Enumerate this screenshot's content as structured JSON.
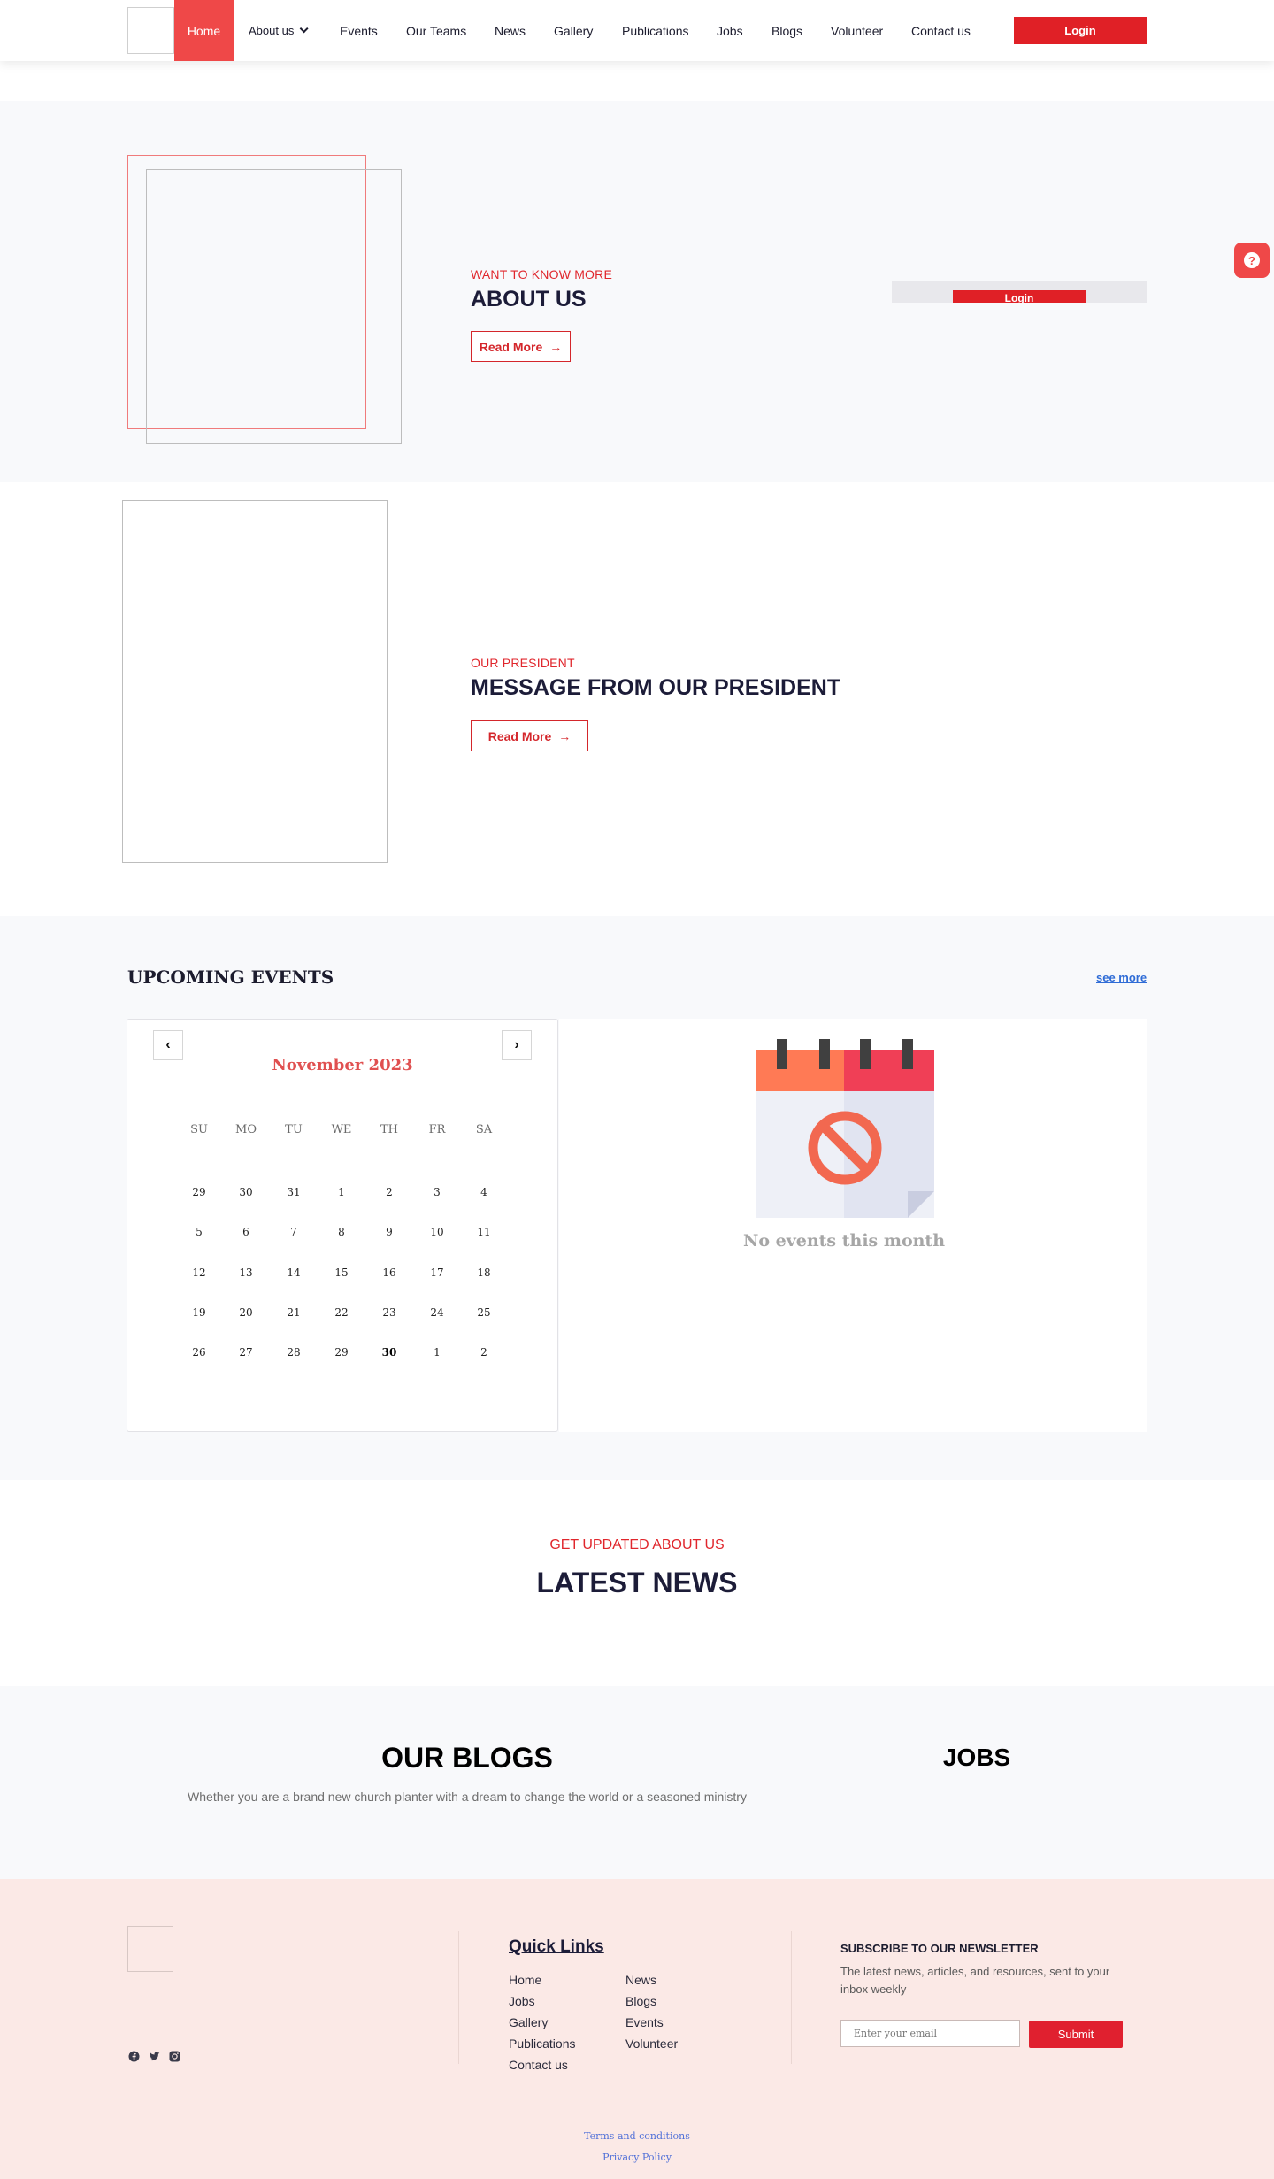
{
  "nav": {
    "home": "Home",
    "about": "About us",
    "events": "Events",
    "teams": "Our Teams",
    "news": "News",
    "gallery": "Gallery",
    "publications": "Publications",
    "jobs": "Jobs",
    "blogs": "Blogs",
    "volunteer": "Volunteer",
    "contact": "Contact us",
    "login": "Login",
    "active_color": "#ef4848",
    "login_color": "#e02026"
  },
  "about": {
    "eyebrow": "WANT TO KNOW MORE",
    "title": "ABOUT US",
    "button": "Read More",
    "mini_login": "Login"
  },
  "help": {
    "icon": "help-question-icon"
  },
  "president": {
    "eyebrow": "OUR PRESIDENT",
    "title": "MESSAGE FROM OUR PRESIDENT",
    "button": "Read More"
  },
  "events": {
    "title": "UPCOMING EVENTS",
    "see_more": "see more",
    "month": "November 2023",
    "weekdays": [
      "SU",
      "MO",
      "TU",
      "WE",
      "TH",
      "FR",
      "SA"
    ],
    "weeks": [
      [
        "29",
        "30",
        "31",
        "1",
        "2",
        "3",
        "4"
      ],
      [
        "5",
        "6",
        "7",
        "8",
        "9",
        "10",
        "11"
      ],
      [
        "12",
        "13",
        "14",
        "15",
        "16",
        "17",
        "18"
      ],
      [
        "19",
        "20",
        "21",
        "22",
        "23",
        "24",
        "25"
      ],
      [
        "26",
        "27",
        "28",
        "29",
        "30",
        "1",
        "2"
      ]
    ],
    "today": "30",
    "empty_message": "No events this month"
  },
  "news": {
    "eyebrow": "GET UPDATED ABOUT US",
    "title": "LATEST NEWS"
  },
  "blogs": {
    "title": "OUR BLOGS",
    "subtitle": "Whether you are a brand new church planter with a dream to change the world or a seasoned ministry"
  },
  "jobs": {
    "title": "JOBS"
  },
  "footer": {
    "quick_links_title": "Quick Links",
    "links_col1": [
      "Home",
      "Jobs",
      "Gallery",
      "Publications",
      "Contact us"
    ],
    "links_col2": [
      "News",
      "Blogs",
      "Events",
      "Volunteer"
    ],
    "social_icons": [
      "facebook-icon",
      "twitter-icon",
      "instagram-icon"
    ],
    "newsletter_title": "SUBSCRIBE TO OUR NEWSLETTER",
    "newsletter_text": "The latest news, articles, and resources, sent to your inbox weekly",
    "email_placeholder": "Enter your email",
    "submit": "Submit",
    "terms": "Terms and conditions",
    "privacy": "Privacy Policy"
  }
}
